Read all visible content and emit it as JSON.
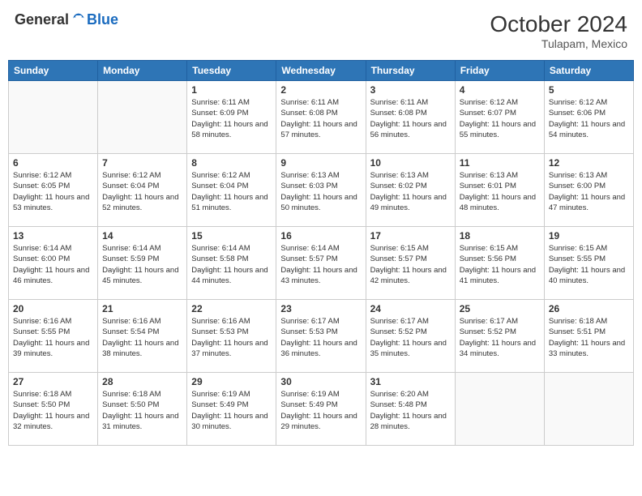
{
  "logo": {
    "general": "General",
    "blue": "Blue"
  },
  "header": {
    "month": "October 2024",
    "location": "Tulapam, Mexico"
  },
  "weekdays": [
    "Sunday",
    "Monday",
    "Tuesday",
    "Wednesday",
    "Thursday",
    "Friday",
    "Saturday"
  ],
  "weeks": [
    [
      {
        "day": "",
        "sunrise": "",
        "sunset": "",
        "daylight": ""
      },
      {
        "day": "",
        "sunrise": "",
        "sunset": "",
        "daylight": ""
      },
      {
        "day": "1",
        "sunrise": "Sunrise: 6:11 AM",
        "sunset": "Sunset: 6:09 PM",
        "daylight": "Daylight: 11 hours and 58 minutes."
      },
      {
        "day": "2",
        "sunrise": "Sunrise: 6:11 AM",
        "sunset": "Sunset: 6:08 PM",
        "daylight": "Daylight: 11 hours and 57 minutes."
      },
      {
        "day": "3",
        "sunrise": "Sunrise: 6:11 AM",
        "sunset": "Sunset: 6:08 PM",
        "daylight": "Daylight: 11 hours and 56 minutes."
      },
      {
        "day": "4",
        "sunrise": "Sunrise: 6:12 AM",
        "sunset": "Sunset: 6:07 PM",
        "daylight": "Daylight: 11 hours and 55 minutes."
      },
      {
        "day": "5",
        "sunrise": "Sunrise: 6:12 AM",
        "sunset": "Sunset: 6:06 PM",
        "daylight": "Daylight: 11 hours and 54 minutes."
      }
    ],
    [
      {
        "day": "6",
        "sunrise": "Sunrise: 6:12 AM",
        "sunset": "Sunset: 6:05 PM",
        "daylight": "Daylight: 11 hours and 53 minutes."
      },
      {
        "day": "7",
        "sunrise": "Sunrise: 6:12 AM",
        "sunset": "Sunset: 6:04 PM",
        "daylight": "Daylight: 11 hours and 52 minutes."
      },
      {
        "day": "8",
        "sunrise": "Sunrise: 6:12 AM",
        "sunset": "Sunset: 6:04 PM",
        "daylight": "Daylight: 11 hours and 51 minutes."
      },
      {
        "day": "9",
        "sunrise": "Sunrise: 6:13 AM",
        "sunset": "Sunset: 6:03 PM",
        "daylight": "Daylight: 11 hours and 50 minutes."
      },
      {
        "day": "10",
        "sunrise": "Sunrise: 6:13 AM",
        "sunset": "Sunset: 6:02 PM",
        "daylight": "Daylight: 11 hours and 49 minutes."
      },
      {
        "day": "11",
        "sunrise": "Sunrise: 6:13 AM",
        "sunset": "Sunset: 6:01 PM",
        "daylight": "Daylight: 11 hours and 48 minutes."
      },
      {
        "day": "12",
        "sunrise": "Sunrise: 6:13 AM",
        "sunset": "Sunset: 6:00 PM",
        "daylight": "Daylight: 11 hours and 47 minutes."
      }
    ],
    [
      {
        "day": "13",
        "sunrise": "Sunrise: 6:14 AM",
        "sunset": "Sunset: 6:00 PM",
        "daylight": "Daylight: 11 hours and 46 minutes."
      },
      {
        "day": "14",
        "sunrise": "Sunrise: 6:14 AM",
        "sunset": "Sunset: 5:59 PM",
        "daylight": "Daylight: 11 hours and 45 minutes."
      },
      {
        "day": "15",
        "sunrise": "Sunrise: 6:14 AM",
        "sunset": "Sunset: 5:58 PM",
        "daylight": "Daylight: 11 hours and 44 minutes."
      },
      {
        "day": "16",
        "sunrise": "Sunrise: 6:14 AM",
        "sunset": "Sunset: 5:57 PM",
        "daylight": "Daylight: 11 hours and 43 minutes."
      },
      {
        "day": "17",
        "sunrise": "Sunrise: 6:15 AM",
        "sunset": "Sunset: 5:57 PM",
        "daylight": "Daylight: 11 hours and 42 minutes."
      },
      {
        "day": "18",
        "sunrise": "Sunrise: 6:15 AM",
        "sunset": "Sunset: 5:56 PM",
        "daylight": "Daylight: 11 hours and 41 minutes."
      },
      {
        "day": "19",
        "sunrise": "Sunrise: 6:15 AM",
        "sunset": "Sunset: 5:55 PM",
        "daylight": "Daylight: 11 hours and 40 minutes."
      }
    ],
    [
      {
        "day": "20",
        "sunrise": "Sunrise: 6:16 AM",
        "sunset": "Sunset: 5:55 PM",
        "daylight": "Daylight: 11 hours and 39 minutes."
      },
      {
        "day": "21",
        "sunrise": "Sunrise: 6:16 AM",
        "sunset": "Sunset: 5:54 PM",
        "daylight": "Daylight: 11 hours and 38 minutes."
      },
      {
        "day": "22",
        "sunrise": "Sunrise: 6:16 AM",
        "sunset": "Sunset: 5:53 PM",
        "daylight": "Daylight: 11 hours and 37 minutes."
      },
      {
        "day": "23",
        "sunrise": "Sunrise: 6:17 AM",
        "sunset": "Sunset: 5:53 PM",
        "daylight": "Daylight: 11 hours and 36 minutes."
      },
      {
        "day": "24",
        "sunrise": "Sunrise: 6:17 AM",
        "sunset": "Sunset: 5:52 PM",
        "daylight": "Daylight: 11 hours and 35 minutes."
      },
      {
        "day": "25",
        "sunrise": "Sunrise: 6:17 AM",
        "sunset": "Sunset: 5:52 PM",
        "daylight": "Daylight: 11 hours and 34 minutes."
      },
      {
        "day": "26",
        "sunrise": "Sunrise: 6:18 AM",
        "sunset": "Sunset: 5:51 PM",
        "daylight": "Daylight: 11 hours and 33 minutes."
      }
    ],
    [
      {
        "day": "27",
        "sunrise": "Sunrise: 6:18 AM",
        "sunset": "Sunset: 5:50 PM",
        "daylight": "Daylight: 11 hours and 32 minutes."
      },
      {
        "day": "28",
        "sunrise": "Sunrise: 6:18 AM",
        "sunset": "Sunset: 5:50 PM",
        "daylight": "Daylight: 11 hours and 31 minutes."
      },
      {
        "day": "29",
        "sunrise": "Sunrise: 6:19 AM",
        "sunset": "Sunset: 5:49 PM",
        "daylight": "Daylight: 11 hours and 30 minutes."
      },
      {
        "day": "30",
        "sunrise": "Sunrise: 6:19 AM",
        "sunset": "Sunset: 5:49 PM",
        "daylight": "Daylight: 11 hours and 29 minutes."
      },
      {
        "day": "31",
        "sunrise": "Sunrise: 6:20 AM",
        "sunset": "Sunset: 5:48 PM",
        "daylight": "Daylight: 11 hours and 28 minutes."
      },
      {
        "day": "",
        "sunrise": "",
        "sunset": "",
        "daylight": ""
      },
      {
        "day": "",
        "sunrise": "",
        "sunset": "",
        "daylight": ""
      }
    ]
  ]
}
